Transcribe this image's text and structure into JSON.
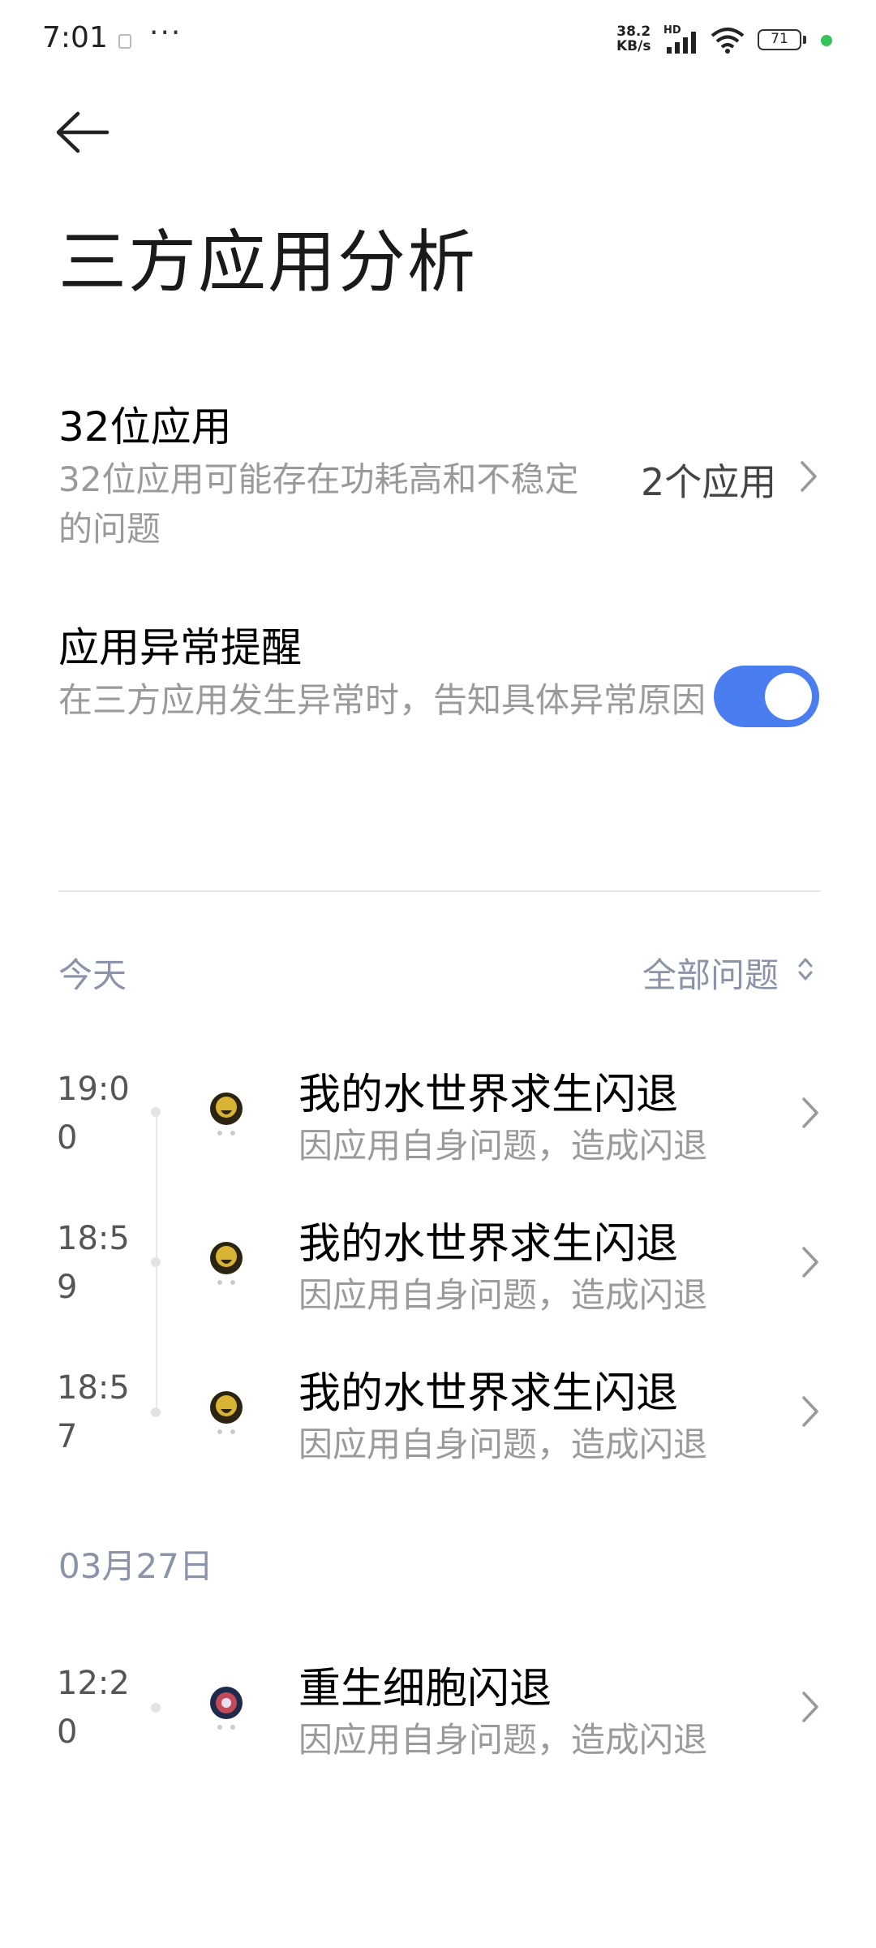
{
  "status_bar": {
    "time": "7:01",
    "net_speed_value": "38.2",
    "net_speed_unit": "KB/s",
    "network_badge": "HD",
    "battery": "71",
    "icons": [
      "notification-icon",
      "more-dots-icon",
      "signal-icon",
      "wifi-icon",
      "battery-icon"
    ]
  },
  "header": {
    "title": "三方应用分析"
  },
  "settings": {
    "app32": {
      "title": "32位应用",
      "description": "32位应用可能存在功耗高和不稳定的问题",
      "value": "2个应用"
    },
    "alert": {
      "title": "应用异常提醒",
      "description": "在三方应用发生异常时，告知具体异常原因",
      "enabled": true
    }
  },
  "log": {
    "filter_label": "全部问题",
    "groups": [
      {
        "date": "今天",
        "items": [
          {
            "time": "19:00",
            "title": "我的水世界求生闪退",
            "subtitle": "因应用自身问题，造成闪退"
          },
          {
            "time": "18:59",
            "title": "我的水世界求生闪退",
            "subtitle": "因应用自身问题，造成闪退"
          },
          {
            "time": "18:57",
            "title": "我的水世界求生闪退",
            "subtitle": "因应用自身问题，造成闪退"
          }
        ]
      },
      {
        "date": "03月27日",
        "items": [
          {
            "time": "12:20",
            "title": "重生细胞闪退",
            "subtitle": "因应用自身问题，造成闪退"
          }
        ]
      }
    ]
  },
  "colors": {
    "accent": "#4a7ef0",
    "secondary_text": "#9a9a9a",
    "group_label": "#8a93a8",
    "status_green": "#36c45a"
  }
}
